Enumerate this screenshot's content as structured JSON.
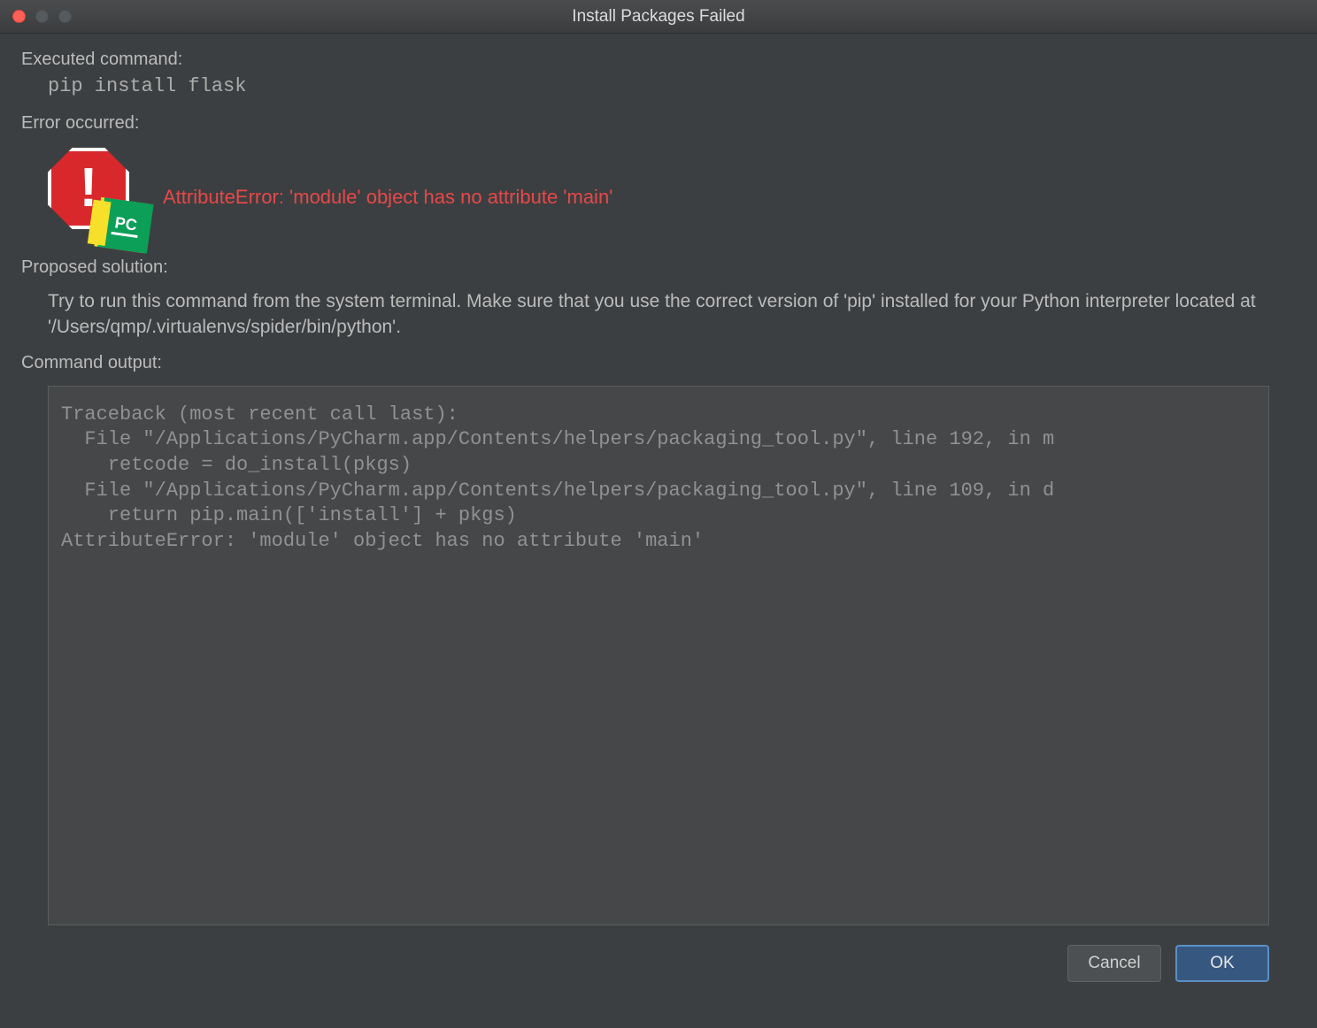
{
  "window": {
    "title": "Install Packages Failed"
  },
  "labels": {
    "executed_command": "Executed command:",
    "error_occurred": "Error occurred:",
    "proposed_solution": "Proposed solution:",
    "command_output": "Command output:"
  },
  "command": "pip install flask",
  "error_message": "AttributeError: 'module' object has no attribute 'main'",
  "solution_text": "Try to run this command from the system terminal. Make sure that you use the correct version of 'pip' installed for your Python interpreter located at '/Users/qmp/.virtualenvs/spider/bin/python'.",
  "command_output": "Traceback (most recent call last):\n  File \"/Applications/PyCharm.app/Contents/helpers/packaging_tool.py\", line 192, in m\n    retcode = do_install(pkgs)\n  File \"/Applications/PyCharm.app/Contents/helpers/packaging_tool.py\", line 109, in d\n    return pip.main(['install'] + pkgs)\nAttributeError: 'module' object has no attribute 'main'\n",
  "buttons": {
    "cancel": "Cancel",
    "ok": "OK"
  },
  "icons": {
    "pc_badge": "PC"
  }
}
